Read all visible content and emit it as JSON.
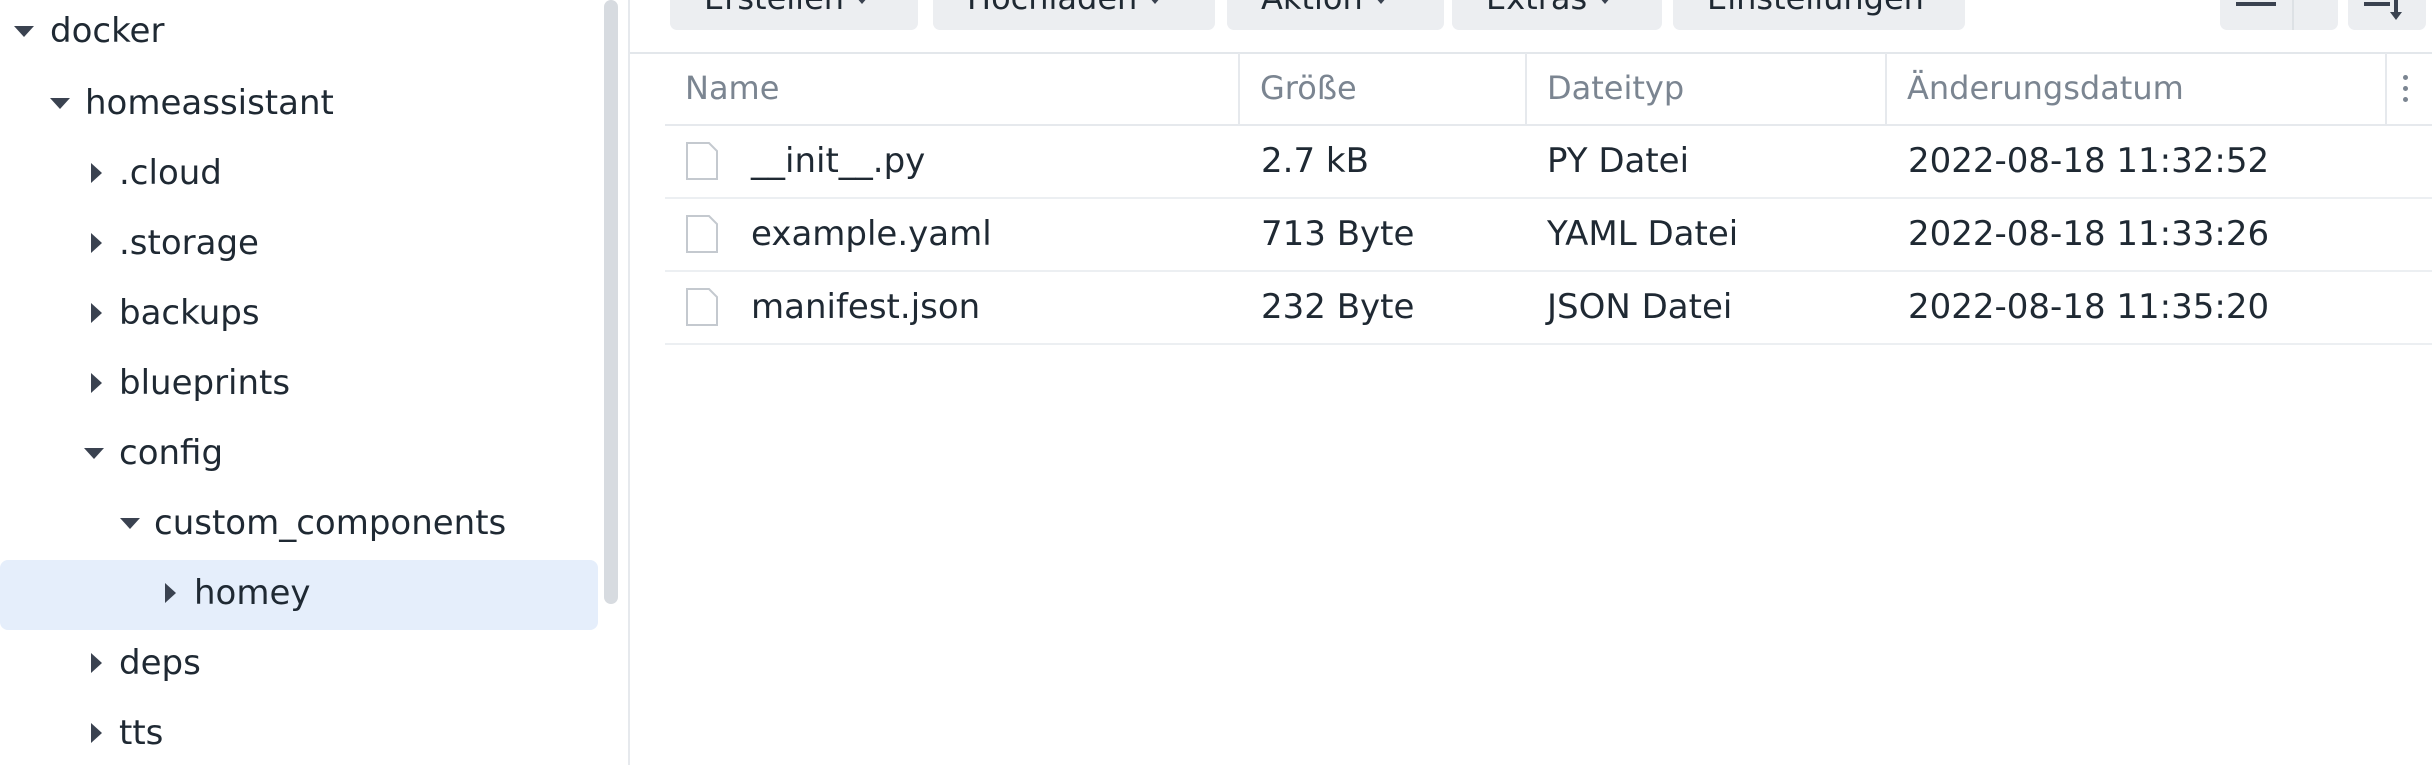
{
  "tree": {
    "nodes": [
      {
        "label": "docker",
        "expanded": true,
        "level": 0,
        "selected": false
      },
      {
        "label": "homeassistant",
        "expanded": true,
        "level": 1,
        "selected": false
      },
      {
        "label": ".cloud",
        "expanded": false,
        "level": 2,
        "selected": false
      },
      {
        "label": ".storage",
        "expanded": false,
        "level": 2,
        "selected": false
      },
      {
        "label": "backups",
        "expanded": false,
        "level": 2,
        "selected": false
      },
      {
        "label": "blueprints",
        "expanded": false,
        "level": 2,
        "selected": false
      },
      {
        "label": "config",
        "expanded": true,
        "level": 2,
        "selected": false
      },
      {
        "label": "custom_components",
        "expanded": true,
        "level": 3,
        "selected": false
      },
      {
        "label": "homey",
        "expanded": false,
        "level": 4,
        "selected": true
      },
      {
        "label": "deps",
        "expanded": false,
        "level": 2,
        "selected": false
      },
      {
        "label": "tts",
        "expanded": false,
        "level": 2,
        "selected": false
      }
    ]
  },
  "toolbar": {
    "create_label": "Erstellen",
    "upload_label": "Hochladen",
    "action_label": "Aktion",
    "extras_label": "Extras",
    "settings_label": "Einstellungen"
  },
  "table": {
    "columns": [
      "Name",
      "Größe",
      "Dateityp",
      "Änderungsdatum"
    ],
    "rows": [
      {
        "name": "__init__.py",
        "size": "2.7 kB",
        "type": "PY Datei",
        "modified": "2022-08-18 11:32:52"
      },
      {
        "name": "example.yaml",
        "size": "713 Byte",
        "type": "YAML Datei",
        "modified": "2022-08-18 11:33:26"
      },
      {
        "name": "manifest.json",
        "size": "232 Byte",
        "type": "JSON Datei",
        "modified": "2022-08-18 11:35:20"
      }
    ]
  },
  "colors": {
    "selected_row_bg": "#e5eefb",
    "button_bg": "#eceef1",
    "header_text": "#7b8591"
  }
}
